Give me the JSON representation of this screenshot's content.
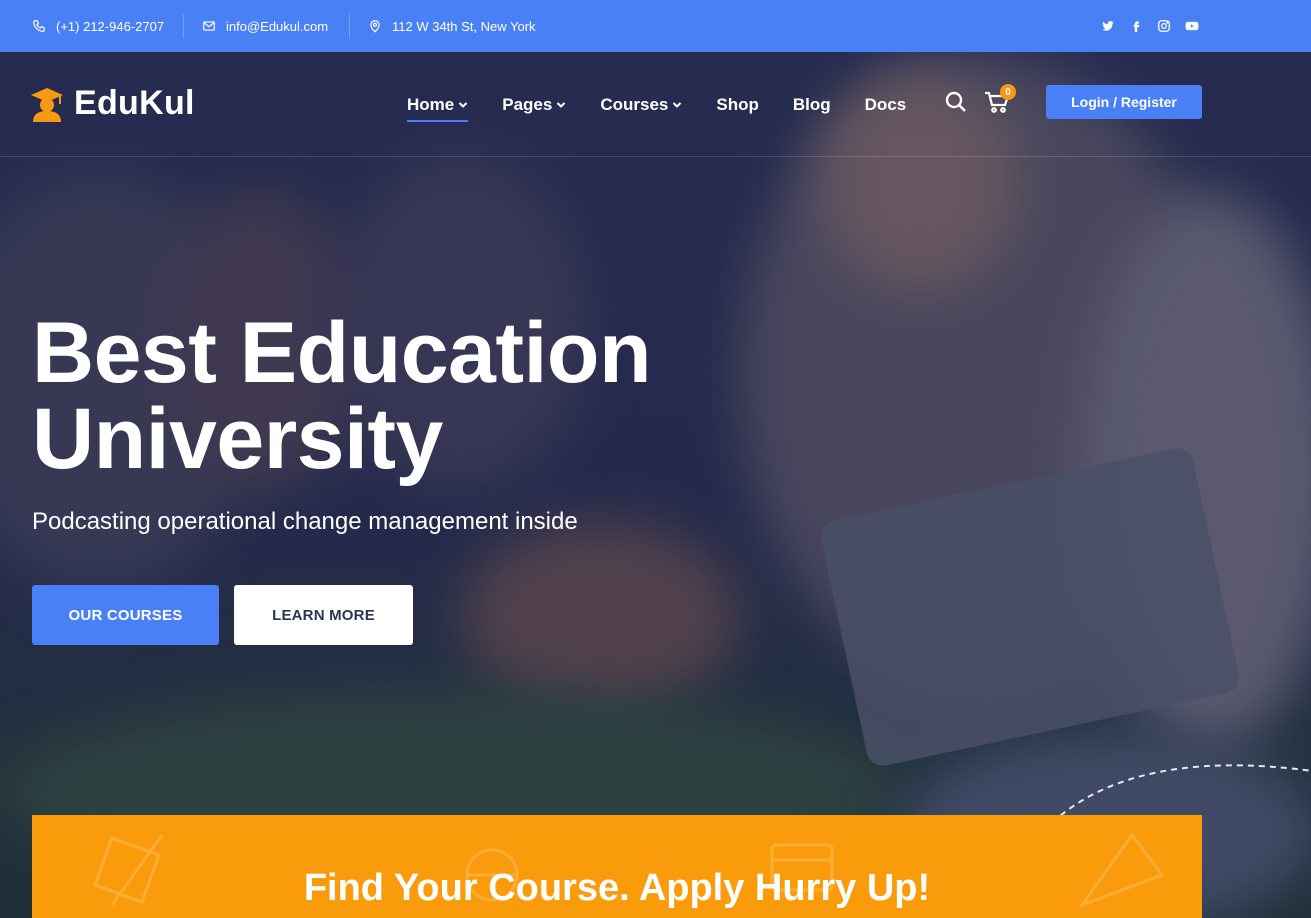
{
  "topbar": {
    "phone": "(+1) 212-946-2707",
    "email": "info@Edukul.com",
    "address": "112 W 34th St, New York",
    "socials": [
      "twitter-icon",
      "facebook-icon",
      "instagram-icon",
      "youtube-icon"
    ]
  },
  "brand": {
    "name": "EduKul",
    "logo_icon": "graduate-icon"
  },
  "nav": {
    "items": [
      {
        "label": "Home",
        "dropdown": true,
        "active": true
      },
      {
        "label": "Pages",
        "dropdown": true
      },
      {
        "label": "Courses",
        "dropdown": true
      },
      {
        "label": "Shop",
        "dropdown": false
      },
      {
        "label": "Blog",
        "dropdown": false
      },
      {
        "label": "Docs",
        "dropdown": false
      }
    ],
    "cart_count": "0",
    "login_label": "Login / Register"
  },
  "hero": {
    "title_line1": "Best Education",
    "title_line2": "University",
    "subtitle": "Podcasting operational change management inside",
    "primary_cta": "OUR COURSES",
    "secondary_cta": "LEARN MORE"
  },
  "banner": {
    "title": "Find Your Course. Apply Hurry Up!"
  },
  "colors": {
    "primary": "#4a80f5",
    "accent": "#f99b0b",
    "dark_text": "#2c3551"
  }
}
